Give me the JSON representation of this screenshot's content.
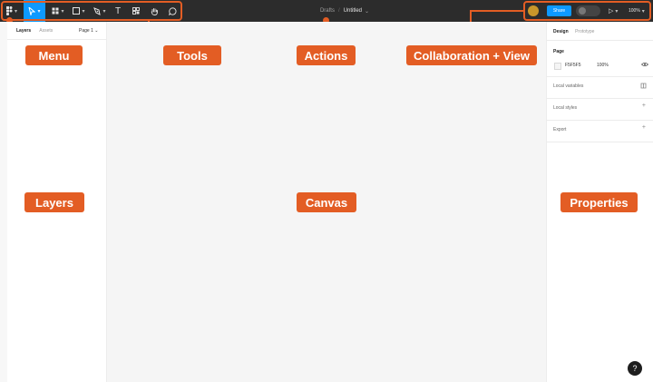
{
  "toolbar": {
    "file": {
      "location": "Drafts",
      "separator": "/",
      "name": "Untitled",
      "caret": "⌄"
    },
    "share_label": "Share",
    "zoom_label": "100%",
    "present_glyph": "▷",
    "text_tool_glyph": "T",
    "caret": "▾"
  },
  "left_panel": {
    "tabs": [
      "Layers",
      "Assets"
    ],
    "page_selector": "Page 1 ⌄"
  },
  "right_panel": {
    "tabs": [
      "Design",
      "Prototype"
    ],
    "page_section": "Page",
    "bg_color": "F5F5F5",
    "bg_opacity": "100%",
    "sections": [
      "Local variables",
      "Local styles",
      "Export"
    ],
    "plus": "+"
  },
  "annotations": {
    "menu": "Menu",
    "tools": "Tools",
    "actions": "Actions",
    "collab_view": "Collaboration + View",
    "layers": "Layers",
    "canvas": "Canvas",
    "properties": "Properties"
  },
  "help_label": "?",
  "colors": {
    "annotation": "#e35d24",
    "toolbar_bg": "#2c2c2c",
    "active_tool": "#0d99ff",
    "canvas_bg": "#f5f5f5"
  },
  "icons": [
    "figma-menu-icon",
    "move-tool-icon",
    "frame-tool-icon",
    "shape-tool-icon",
    "pen-tool-icon",
    "text-tool-icon",
    "resources-icon",
    "hand-tool-icon",
    "comment-icon",
    "present-icon",
    "eye-icon",
    "help-icon"
  ]
}
